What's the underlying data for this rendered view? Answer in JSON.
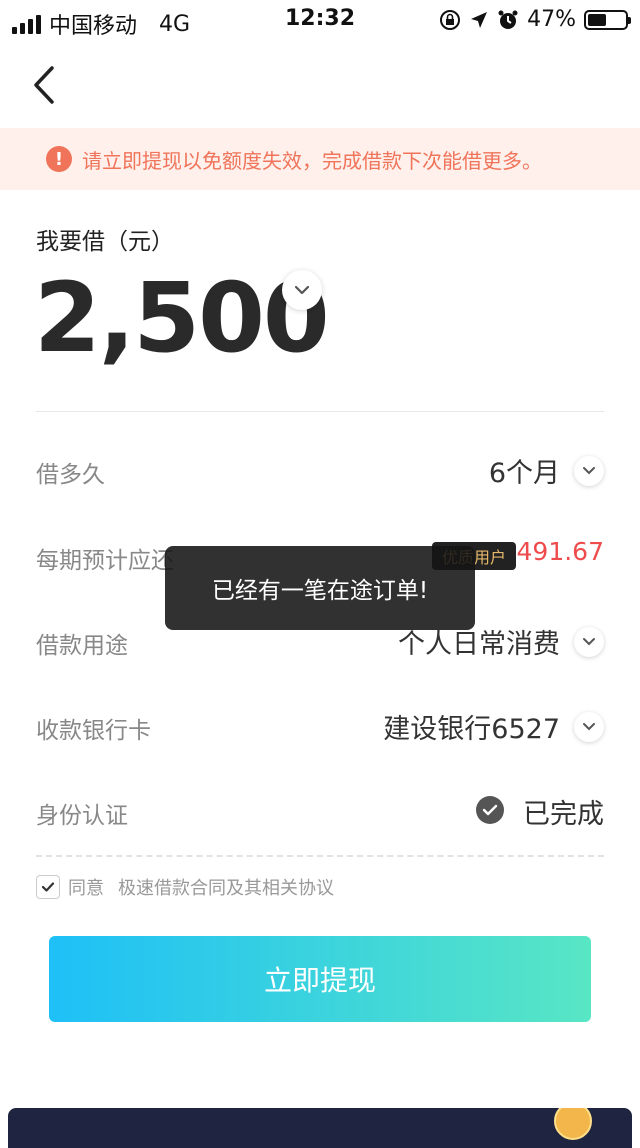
{
  "statusbar": {
    "carrier": "中国移动",
    "network": "4G",
    "time": "12:32",
    "battery": "47%"
  },
  "notice": {
    "text": "请立即提现以免额度失效，完成借款下次能借更多。",
    "icon": "!"
  },
  "loan": {
    "amount_label": "我要借（元）",
    "amount": "2,500"
  },
  "rows": {
    "term": {
      "label": "借多久",
      "value": "6个月"
    },
    "installment": {
      "label": "每期预计应还",
      "badge": "优质用户",
      "value": "491.67"
    },
    "purpose": {
      "label": "借款用途",
      "value": "个人日常消费"
    },
    "bank": {
      "label": "收款银行卡",
      "value": "建设银行6527"
    },
    "identity": {
      "label": "身份认证",
      "value": "已完成"
    }
  },
  "agreement": {
    "checked": true,
    "prefix": "同意",
    "link": "极速借款合同及其相关协议"
  },
  "submit_label": "立即提现",
  "toast": "已经有一笔在途订单!",
  "colors": {
    "accent_start": "#1ec0f7",
    "accent_end": "#58e6c4",
    "warning": "#f0745a",
    "amount_red": "#ee4c4c"
  }
}
